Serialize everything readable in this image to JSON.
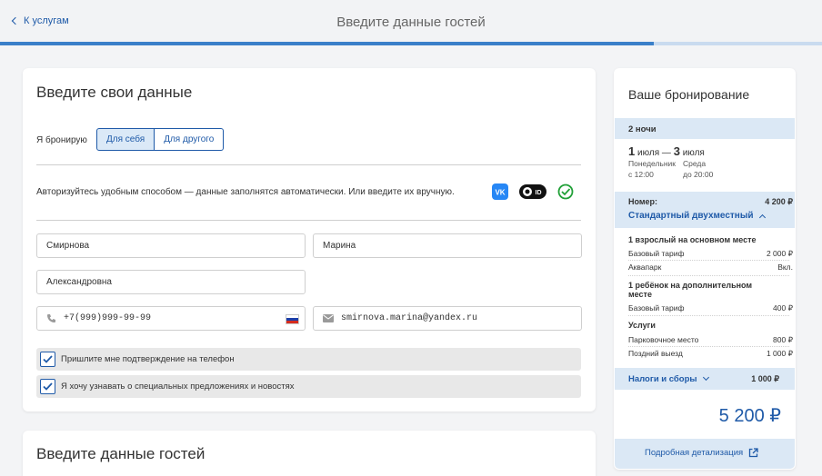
{
  "header": {
    "back_label": "К услугам",
    "title": "Введите данные гостей",
    "progress_fraction": 0.795
  },
  "contact_form": {
    "title": "Введите свои данные",
    "book_for_label": "Я бронирую",
    "book_for_options": [
      "Для себя",
      "Для другого"
    ],
    "book_for_selected": "Для себя",
    "auth_text": "Авторизуйтесь удобным способом — данные заполнятся автоматически. Или введите их вручную.",
    "auth_icons": [
      "vk-icon",
      "yandex-id-icon",
      "sber-id-icon"
    ],
    "last_name": "Смирнова",
    "first_name": "Марина",
    "middle_name": "Александровна",
    "phone": "+7(999)999-99-99",
    "email": "smirnova.marina@yandex.ru",
    "checkbox_phone_label": "Пришлите мне подтверждение на телефон",
    "checkbox_phone_checked": true,
    "checkbox_news_label": "Я хочу узнавать о специальных предложениях и новостях",
    "checkbox_news_checked": true
  },
  "guests_form": {
    "title": "Введите данные гостей"
  },
  "booking": {
    "title": "Ваше бронирование",
    "nights": "2 ночи",
    "checkin_day": "1",
    "checkin_month": "июля",
    "checkin_weekday": "Понедельник",
    "checkin_time": "с 12:00",
    "dash": "—",
    "checkout_day": "3",
    "checkout_month": "июля",
    "checkout_weekday": "Среда",
    "checkout_time": "до 20:00",
    "room_label": "Номер:",
    "room_price": "4 200 ₽",
    "room_name": "Стандартный двухместный",
    "adult_heading": "1 взрослый на основном месте",
    "adult_rate_label": "Базовый тариф",
    "adult_rate_value": "2 000 ₽",
    "aquapark_label": "Аквапарк",
    "aquapark_value": "Вкл.",
    "child_heading": "1 ребёнок на дополнительном месте",
    "child_rate_label": "Базовый тариф",
    "child_rate_value": "400 ₽",
    "services_heading": "Услуги",
    "parking_label": "Парковочное место",
    "parking_value": "800 ₽",
    "late_checkout_label": "Поздний выезд",
    "late_checkout_value": "1 000 ₽",
    "taxes_label": "Налоги и сборы",
    "taxes_value": "1 000 ₽",
    "total": "5 200 ₽",
    "detail_link": "Подробная детализация"
  },
  "colors": {
    "accent": "#1f5aa8",
    "band": "#dbe8f5",
    "progress_track": "#c9dbef",
    "progress_fill": "#3a7fc9"
  }
}
